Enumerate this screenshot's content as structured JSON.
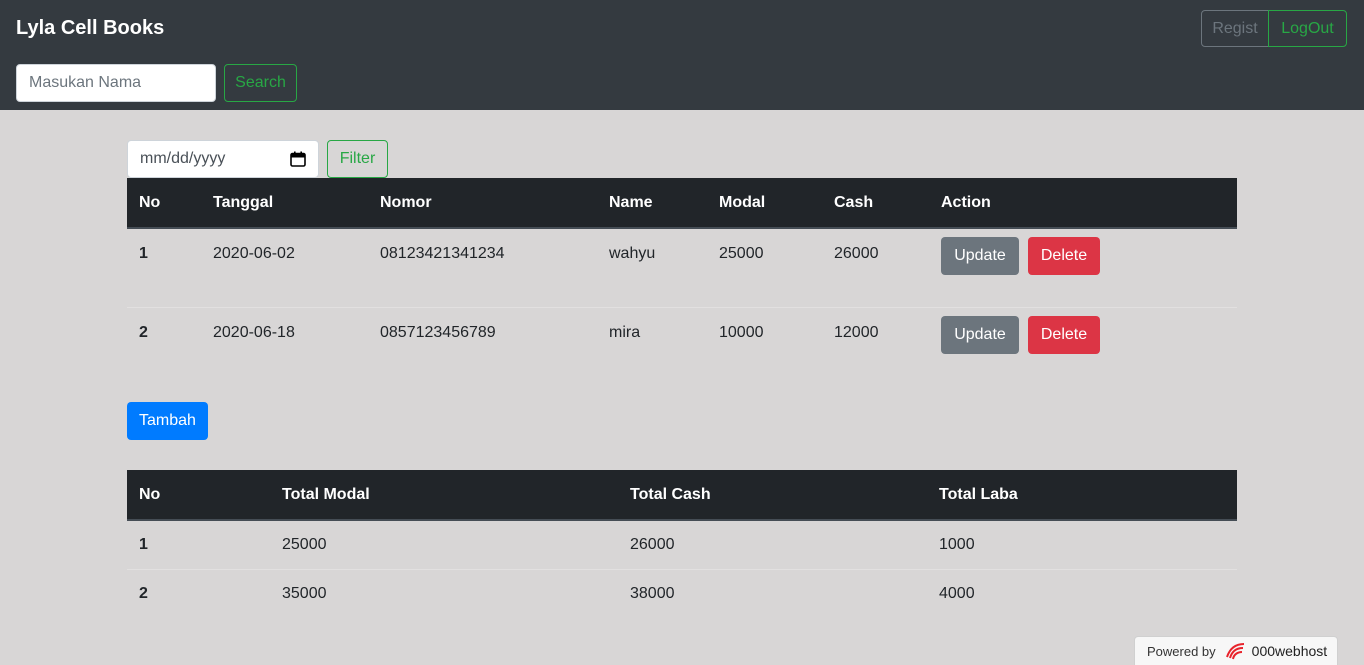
{
  "navbar": {
    "brand": "Lyla Cell Books",
    "search_placeholder": "Masukan Nama",
    "search_label": "Search",
    "regist_label": "Regist",
    "logout_label": "LogOut"
  },
  "filter": {
    "date_placeholder": "mm/dd/yyyy",
    "filter_label": "Filter"
  },
  "main_table": {
    "headers": [
      "No",
      "Tanggal",
      "Nomor",
      "Name",
      "Modal",
      "Cash",
      "Action"
    ],
    "rows": [
      {
        "no": "1",
        "tanggal": "2020-06-02",
        "nomor": "08123421341234",
        "name": "wahyu",
        "modal": "25000",
        "cash": "26000"
      },
      {
        "no": "2",
        "tanggal": "2020-06-18",
        "nomor": "0857123456789",
        "name": "mira",
        "modal": "10000",
        "cash": "12000"
      }
    ],
    "update_label": "Update",
    "delete_label": "Delete"
  },
  "tambah_label": "Tambah",
  "summary_table": {
    "headers": [
      "No",
      "Total Modal",
      "Total Cash",
      "Total Laba"
    ],
    "rows": [
      {
        "no": "1",
        "total_modal": "25000",
        "total_cash": "26000",
        "total_laba": "1000"
      },
      {
        "no": "2",
        "total_modal": "35000",
        "total_cash": "38000",
        "total_laba": "4000"
      }
    ]
  },
  "footer": {
    "powered_by": "Powered by",
    "host_name": "000webhost"
  },
  "colors": {
    "navbar": "#343a40",
    "success": "#28a745",
    "secondary": "#6c757d",
    "danger": "#dc3545",
    "primary": "#007bff",
    "table_head": "#212529"
  },
  "icons": {
    "date_picker": "calendar-icon",
    "host_logo": "000webhost-logo-icon"
  }
}
